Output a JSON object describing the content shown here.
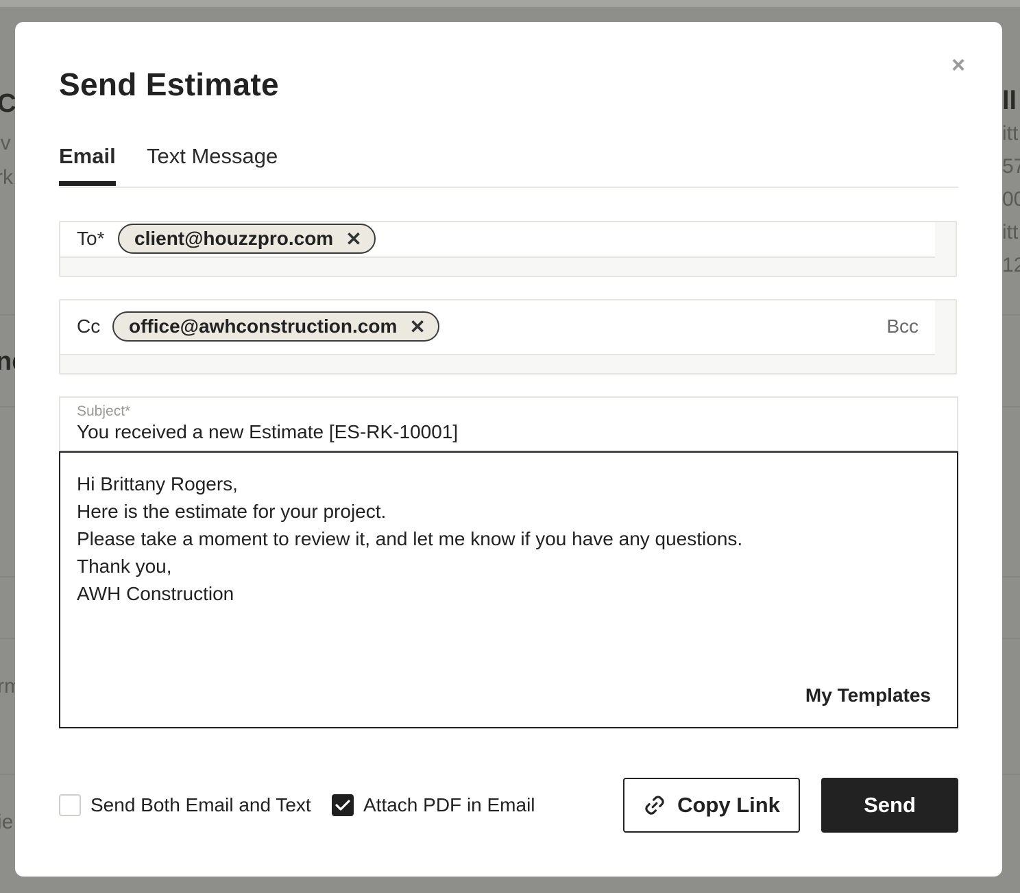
{
  "modal": {
    "title": "Send Estimate",
    "close_label": "×",
    "tabs": [
      {
        "label": "Email",
        "active": true
      },
      {
        "label": "Text Message",
        "active": false
      }
    ],
    "to": {
      "label": "To*",
      "chips": [
        {
          "text": "client@houzzpro.com",
          "remove": "✕"
        }
      ]
    },
    "cc": {
      "label": "Cc",
      "chips": [
        {
          "text": "office@awhconstruction.com",
          "remove": "✕"
        }
      ],
      "bcc_label": "Bcc"
    },
    "subject": {
      "label": "Subject*",
      "value": "You received a new Estimate [ES-RK-10001]"
    },
    "body": {
      "lines": [
        "Hi Brittany Rogers,",
        "Here is the estimate for your project.",
        "Please take a moment to review it, and let me know if you have any questions.",
        "Thank you,",
        "AWH Construction"
      ],
      "templates_label": "My Templates"
    },
    "options": [
      {
        "label": "Send Both Email and Text",
        "checked": false
      },
      {
        "label": "Attach PDF in Email",
        "checked": true
      }
    ],
    "buttons": {
      "copy_link": "Copy Link",
      "send": "Send"
    }
  },
  "background": {
    "fragments": [
      "C",
      "iv",
      "rk",
      "ne",
      "rm",
      "ie",
      "ll",
      "itt",
      "57",
      "00",
      "itt",
      "12"
    ]
  },
  "colors": {
    "primary": "#222222",
    "chip_bg": "#eceae0",
    "overlay": "#8e8f8a"
  }
}
